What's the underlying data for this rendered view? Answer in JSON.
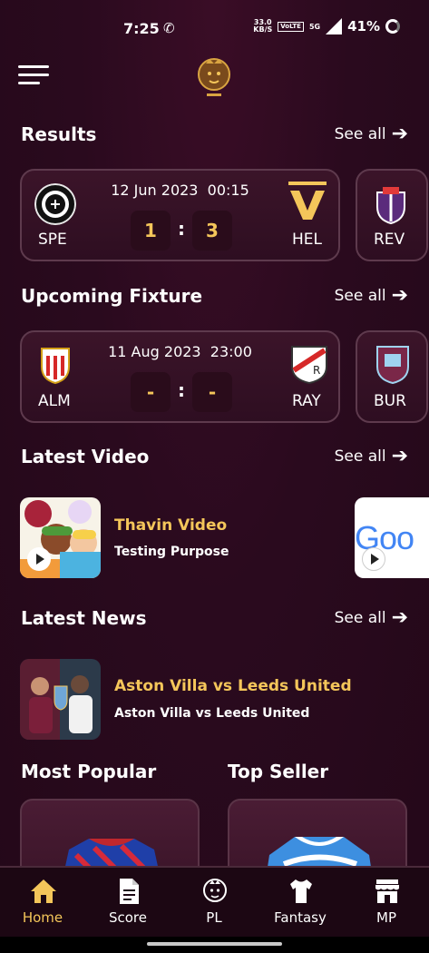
{
  "status_bar": {
    "time": "7:25",
    "net_speed_value": "33.0",
    "net_speed_unit": "KB/S",
    "volte": "VoLTE",
    "network": "5G",
    "battery": "41%"
  },
  "sections": {
    "results": {
      "title": "Results",
      "see_all": "See all"
    },
    "upcoming": {
      "title": "Upcoming Fixture",
      "see_all": "See all"
    },
    "video": {
      "title": "Latest Video",
      "see_all": "See all"
    },
    "news": {
      "title": "Latest News",
      "see_all": "See all"
    },
    "popular": {
      "title": "Most Popular"
    },
    "seller": {
      "title": "Top Seller"
    }
  },
  "results": [
    {
      "home": "SPE",
      "away": "HEL",
      "date": "12 Jun 2023",
      "time": "00:15",
      "home_score": "1",
      "away_score": "3",
      "separator": ":"
    },
    {
      "home": "REV"
    }
  ],
  "fixtures": [
    {
      "home": "ALM",
      "away": "RAY",
      "date": "11 Aug 2023",
      "time": "23:00",
      "home_score": "-",
      "away_score": "-",
      "separator": ":"
    },
    {
      "home": "BUR"
    }
  ],
  "videos": [
    {
      "title": "Thavin Video",
      "subtitle": "Testing Purpose"
    },
    {
      "thumb_text": "Goo"
    }
  ],
  "news": [
    {
      "title": "Aston Villa vs Leeds United",
      "subtitle": "Aston Villa vs Leeds United"
    }
  ],
  "nav": {
    "items": [
      {
        "label": "Home",
        "icon": "home-icon",
        "active": true
      },
      {
        "label": "Score",
        "icon": "document-icon"
      },
      {
        "label": "PL",
        "icon": "lion-logo-icon"
      },
      {
        "label": "Fantasy",
        "icon": "jersey-icon"
      },
      {
        "label": "MP",
        "icon": "storefront-icon"
      }
    ]
  },
  "colors": {
    "accent_gold": "#f4c65a",
    "background": "#2a0a1e",
    "card": "#3b1429",
    "nav_bg": "#1c0713"
  }
}
